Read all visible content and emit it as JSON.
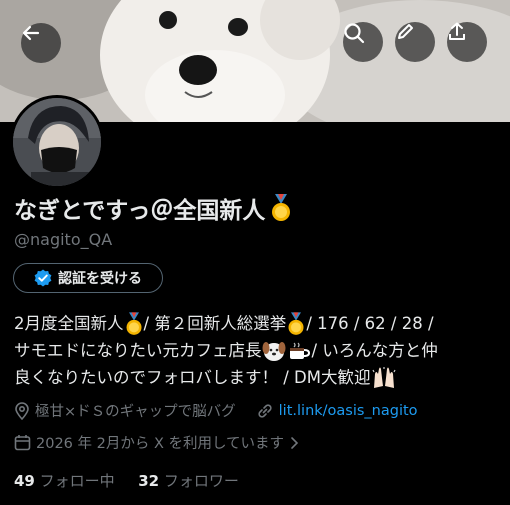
{
  "profile": {
    "display_name": "なぎとですっ＠全国新人",
    "handle": "@nagito_QA",
    "verify_button": "認証を受ける",
    "bio": {
      "line1_a": "2月度全国新人",
      "line1_b": " / 第２回新人総選挙",
      "line1_c": " / 176 / 62 / 28 /",
      "line2_a": "サモエドになりたい元カフェ店長",
      "line2_b": " / いろんな方と仲",
      "line3_a": "良くなりたいのでフォロバします！ / DM大歓迎"
    },
    "location": "極甘×ドＳのギャップで脳バグ",
    "website": "lit.link/oasis_nagito",
    "joined": "2026 年 2月から X を利用しています",
    "following_count": "49",
    "following_label": "フォロー中",
    "followers_count": "32",
    "followers_label": "フォロワー"
  },
  "icons": [
    "back-arrow-icon",
    "search-icon",
    "pencil-icon",
    "share-icon",
    "verified-badge-icon",
    "location-icon",
    "link-icon",
    "calendar-icon",
    "chevron-right-icon",
    "medal-emoji",
    "dog-emoji",
    "coffee-emoji",
    "raised-hands-emoji"
  ],
  "colors": {
    "background": "#000000",
    "text": "#e7e9ea",
    "muted": "#71767b",
    "link": "#1d9bf0",
    "badge": "#1d9bf0"
  }
}
